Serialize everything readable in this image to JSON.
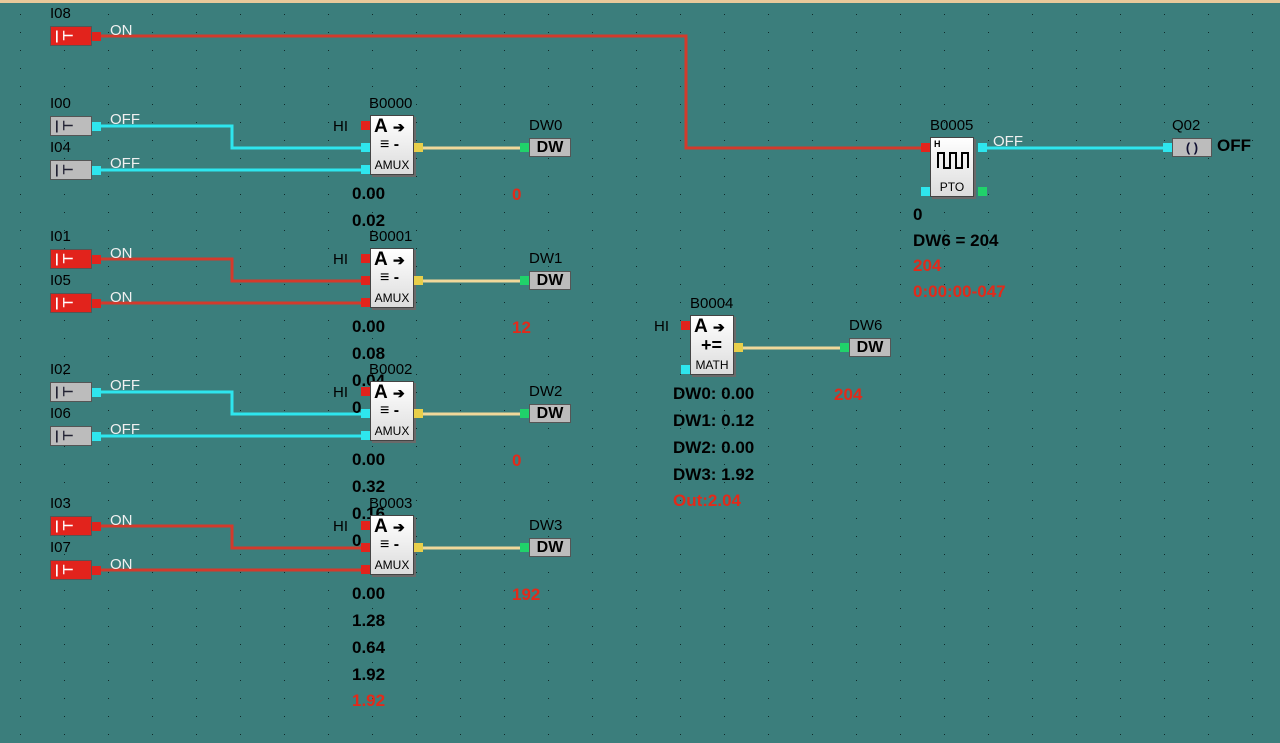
{
  "inputs": {
    "I08": {
      "label": "I08",
      "state": "ON"
    },
    "I00": {
      "label": "I00",
      "state": "OFF"
    },
    "I04": {
      "label": "I04",
      "state": "OFF"
    },
    "I01": {
      "label": "I01",
      "state": "ON"
    },
    "I05": {
      "label": "I05",
      "state": "ON"
    },
    "I02": {
      "label": "I02",
      "state": "OFF"
    },
    "I06": {
      "label": "I06",
      "state": "OFF"
    },
    "I03": {
      "label": "I03",
      "state": "ON"
    },
    "I07": {
      "label": "I07",
      "state": "ON"
    },
    "contact_symbol": "| ⊢"
  },
  "hi_label": "HI",
  "amux": [
    {
      "name": "B0000",
      "caption": "AMUX",
      "output": "DW0",
      "out_value": "0",
      "values": [
        "0.00",
        "0.02"
      ]
    },
    {
      "name": "B0001",
      "caption": "AMUX",
      "output": "DW1",
      "out_value": "12",
      "values": [
        "0.00",
        "0.08",
        "0.04",
        "0"
      ]
    },
    {
      "name": "B0002",
      "caption": "AMUX",
      "output": "DW2",
      "out_value": "0",
      "values": [
        "0.00",
        "0.32",
        "0.16",
        "0"
      ]
    },
    {
      "name": "B0003",
      "caption": "AMUX",
      "output": "DW3",
      "out_value": "192",
      "values": [
        "0.00",
        "1.28",
        "0.64",
        "1.92"
      ],
      "final_value": "1.92"
    }
  ],
  "math": {
    "name": "B0004",
    "caption": "MATH",
    "output": "DW6",
    "out_value": "204",
    "lines": [
      "DW0: 0.00",
      "DW1: 0.12",
      "DW2: 0.00",
      "DW3: 1.92"
    ],
    "out": "Out:2.04"
  },
  "pto": {
    "name": "B0005",
    "caption": "PTO",
    "status": "OFF",
    "value": "0",
    "dw_text": "DW6 = 204",
    "red_value": "204",
    "time": "0:00:00-047"
  },
  "coil": {
    "name": "Q02",
    "state": "OFF",
    "symbol": "( )"
  },
  "block_symbols": {
    "analog": "A",
    "amux_mid": "≡ -",
    "math_mid": "+="
  },
  "dw_label": "DW",
  "colors": {
    "background": "#3b7e7c",
    "wire_on": "#d33a2c",
    "wire_off": "#2ee6ee",
    "wire_analog": "#f0d89a"
  }
}
